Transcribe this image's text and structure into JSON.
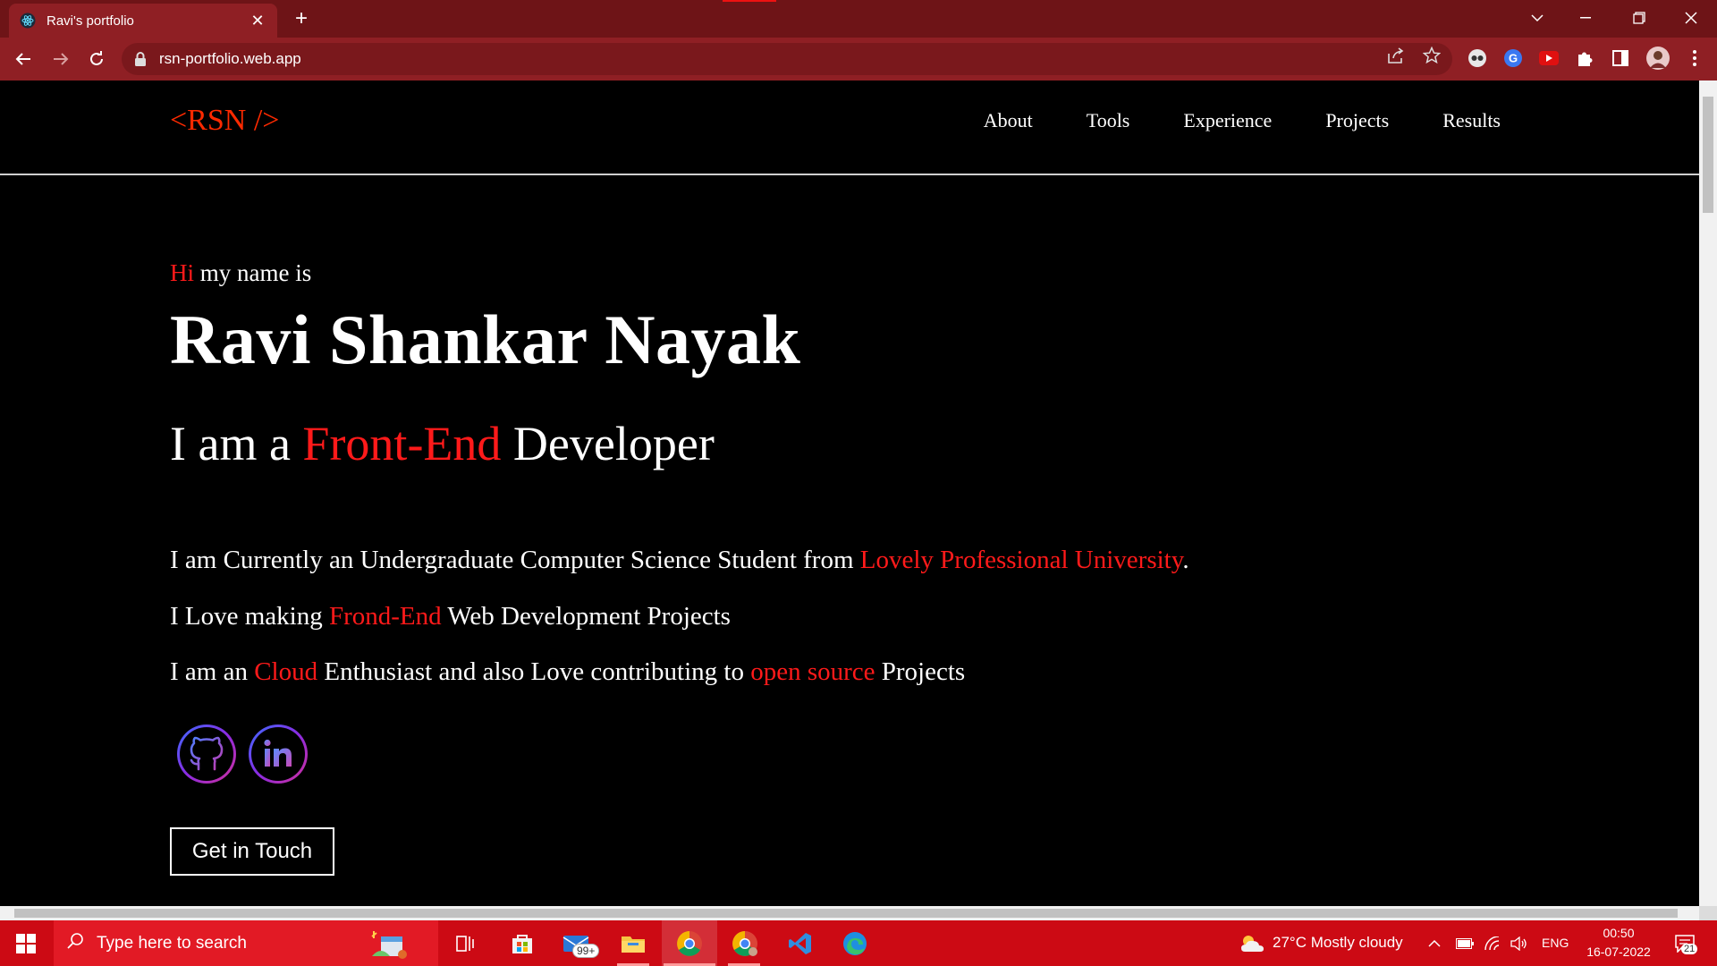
{
  "browser": {
    "tab_title": "Ravi's portfolio",
    "tab_close": "✕",
    "new_tab": "+",
    "url": "rsn-portfolio.web.app"
  },
  "site": {
    "logo": "<RSN />",
    "menu": [
      "About",
      "Tools",
      "Experience",
      "Projects",
      "Results"
    ]
  },
  "hero": {
    "greet_hi": "Hi",
    "greet_rest": " my name is",
    "name": "Ravi Shankar Nayak",
    "role_pre": "I am a ",
    "role_highlight": "Front-End",
    "role_post": " Developer",
    "line1_pre": "I am Currently an Undergraduate Computer Science Student from ",
    "line1_highlight": "Lovely Professional University",
    "line1_post": ".",
    "line2_pre": "I Love making ",
    "line2_highlight": "Frond-End",
    "line2_post": " Web Development Projects",
    "line3_pre": "I am an ",
    "line3_highlight1": "Cloud",
    "line3_mid": " Enthusiast and also Love contributing to ",
    "line3_highlight2": "open source",
    "line3_post": " Projects",
    "cta": "Get in Touch"
  },
  "taskbar": {
    "search_placeholder": "Type here to search",
    "mail_badge": "99+",
    "weather": "27°C  Mostly cloudy",
    "lang": "ENG",
    "time": "00:50",
    "date": "16-07-2022",
    "notifications": "21"
  },
  "colors": {
    "accent_red": "#ff1a1a",
    "logo_orange": "#ff2a00",
    "chrome_red": "#8f1f24",
    "taskbar_red": "#cc0a14"
  }
}
